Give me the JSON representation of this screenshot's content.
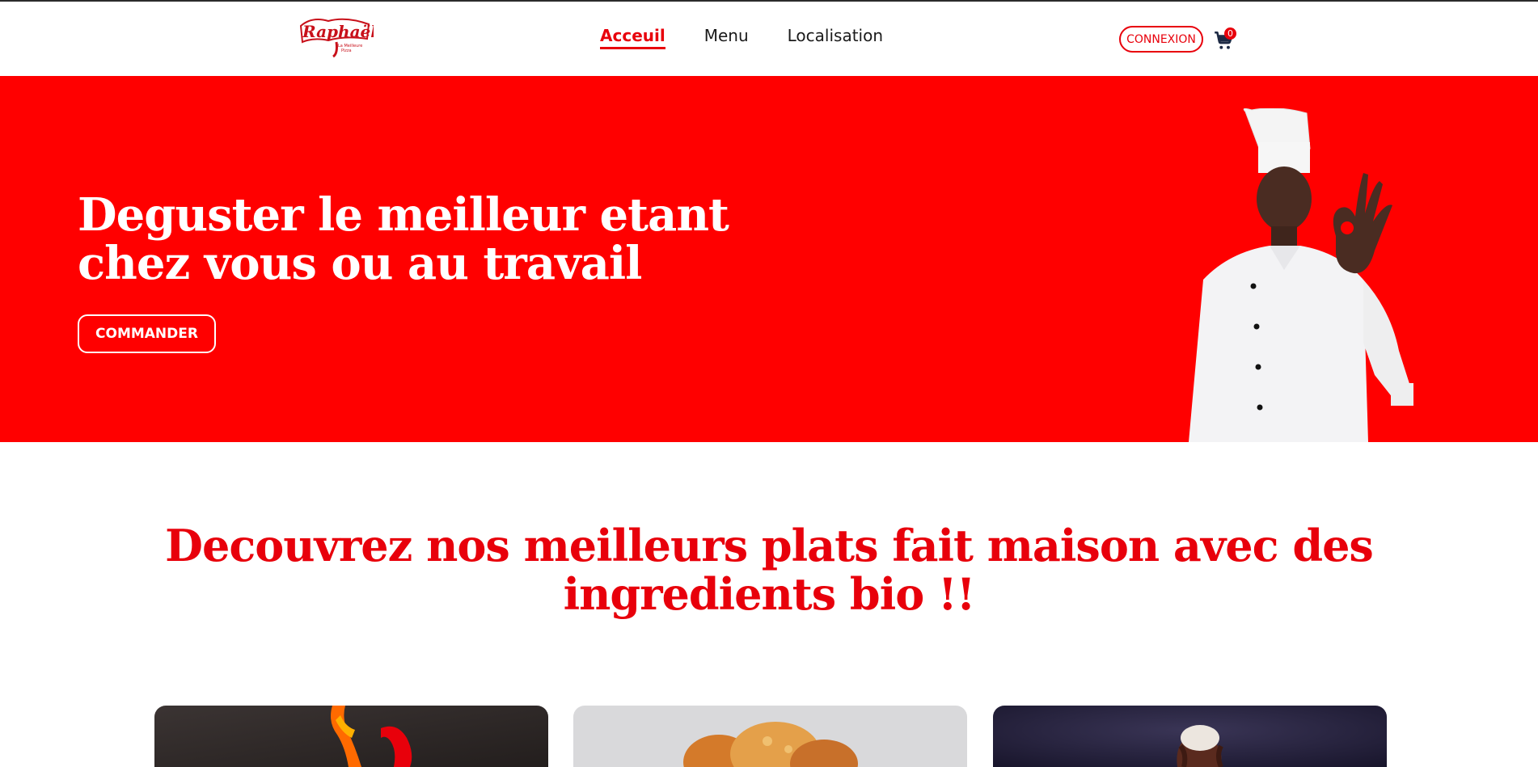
{
  "brand": {
    "logo_name": "Raphaëlo",
    "logo_tagline": "La Meilleure Pizza",
    "accent_color": "#e8000b",
    "hero_color": "#ff0000"
  },
  "nav": {
    "items": [
      {
        "label": "Acceuil",
        "active": true
      },
      {
        "label": "Menu",
        "active": false
      },
      {
        "label": "Localisation",
        "active": false
      }
    ]
  },
  "header": {
    "login_label": "CONNEXION",
    "cart_icon": "cart-icon",
    "cart_count": "0"
  },
  "hero": {
    "title": "Deguster le meilleur etant chez vous ou au travail",
    "cta_label": "COMMANDER",
    "image": "chef-ok-gesture"
  },
  "section": {
    "title": "Decouvrez nos meilleurs plats fait maison avec des ingredients bio !!"
  },
  "cards": [
    {
      "image": "pepper-flame-dish"
    },
    {
      "image": "fried-chicken"
    },
    {
      "image": "chocolate-ice-cream"
    }
  ]
}
